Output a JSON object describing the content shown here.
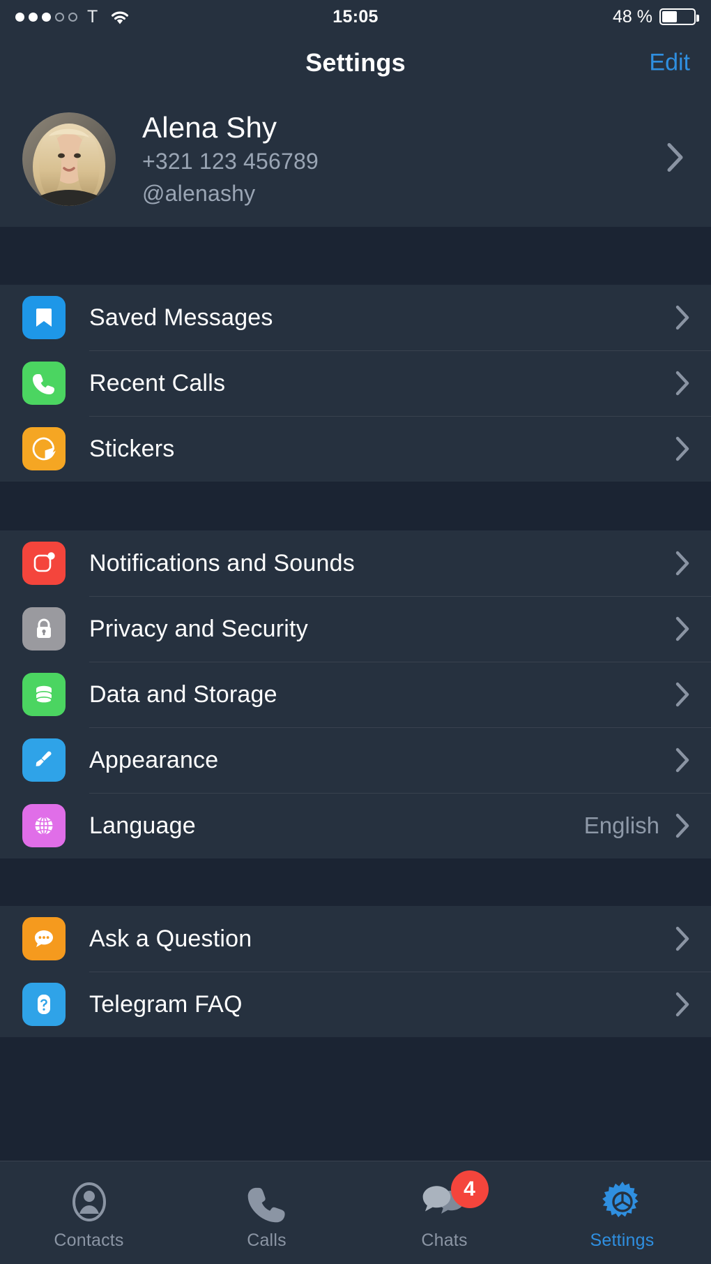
{
  "status_bar": {
    "signal_filled": 3,
    "signal_empty": 2,
    "carrier": "T",
    "wifi_icon": "wifi-icon",
    "time": "15:05",
    "battery_text": "48 %",
    "battery_percent": 48
  },
  "nav": {
    "title": "Settings",
    "edit_label": "Edit",
    "accent_color": "#2f8fe0"
  },
  "profile": {
    "name": "Alena Shy",
    "phone": "+321 123 456789",
    "username": "@alenashy",
    "avatar_name": "user-avatar"
  },
  "groups": [
    {
      "rows": [
        {
          "label": "Saved Messages",
          "value": "",
          "icon": "bookmark-icon",
          "icon_class": "ic-blue",
          "icon_color": "#1e97e8"
        },
        {
          "label": "Recent Calls",
          "value": "",
          "icon": "phone-icon",
          "icon_class": "ic-green",
          "icon_color": "#4bd561"
        },
        {
          "label": "Stickers",
          "value": "",
          "icon": "sticker-icon",
          "icon_class": "ic-orange",
          "icon_color": "#f5a623"
        }
      ]
    },
    {
      "rows": [
        {
          "label": "Notifications and Sounds",
          "value": "",
          "icon": "notification-icon",
          "icon_class": "ic-red",
          "icon_color": "#f4453c"
        },
        {
          "label": "Privacy and Security",
          "value": "",
          "icon": "lock-icon",
          "icon_class": "ic-gray",
          "icon_color": "#9a9a9f"
        },
        {
          "label": "Data and Storage",
          "value": "",
          "icon": "database-icon",
          "icon_class": "ic-green2",
          "icon_color": "#4bd561"
        },
        {
          "label": "Appearance",
          "value": "",
          "icon": "paintbrush-icon",
          "icon_class": "ic-lightblue",
          "icon_color": "#2fa3e8"
        },
        {
          "label": "Language",
          "value": "English",
          "icon": "globe-icon",
          "icon_class": "ic-purple",
          "icon_color": "#e06ee8"
        }
      ]
    },
    {
      "rows": [
        {
          "label": "Ask a Question",
          "value": "",
          "icon": "chat-bubble-icon",
          "icon_class": "ic-orange2",
          "icon_color": "#f59a1e"
        },
        {
          "label": "Telegram FAQ",
          "value": "",
          "icon": "question-mark-icon",
          "icon_class": "ic-sky",
          "icon_color": "#2fa3e8"
        }
      ]
    }
  ],
  "tabs": [
    {
      "label": "Contacts",
      "icon": "contacts-icon",
      "badge": "",
      "active": false
    },
    {
      "label": "Calls",
      "icon": "calls-phone-icon",
      "badge": "",
      "active": false
    },
    {
      "label": "Chats",
      "icon": "chats-bubbles-icon",
      "badge": "4",
      "active": false
    },
    {
      "label": "Settings",
      "icon": "gear-icon",
      "badge": "",
      "active": true
    }
  ],
  "colors": {
    "row_bg": "#26313f",
    "page_bg": "#1b2433",
    "separator": "#39424f",
    "accent": "#2f8fe0",
    "badge_red": "#f4453c",
    "secondary_text": "#9aa5b4"
  }
}
